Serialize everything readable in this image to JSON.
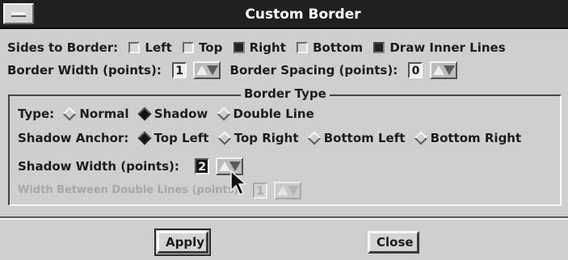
{
  "window": {
    "title": "Custom Border"
  },
  "sides": {
    "label": "Sides to Border:",
    "left": {
      "label": "Left",
      "checked": false
    },
    "top": {
      "label": "Top",
      "checked": false
    },
    "right": {
      "label": "Right",
      "checked": true
    },
    "bottom": {
      "label": "Bottom",
      "checked": false
    },
    "inner": {
      "label": "Draw Inner Lines",
      "checked": true
    }
  },
  "border_width": {
    "label": "Border Width (points):",
    "value": "1"
  },
  "border_spacing": {
    "label": "Border Spacing (points):",
    "value": "0"
  },
  "border_type": {
    "title": "Border Type",
    "type_label": "Type:",
    "types": [
      "Normal",
      "Shadow",
      "Double Line"
    ],
    "selected_type": "Shadow",
    "anchor_label": "Shadow Anchor:",
    "anchors": [
      "Top Left",
      "Top Right",
      "Bottom Left",
      "Bottom Right"
    ],
    "selected_anchor": "Top Left",
    "shadow_width": {
      "label": "Shadow Width (points):",
      "value": "2"
    },
    "double_width": {
      "label": "Width Between Double Lines (points):",
      "value": "1",
      "enabled": false
    }
  },
  "buttons": {
    "apply": "Apply",
    "close": "Close"
  }
}
